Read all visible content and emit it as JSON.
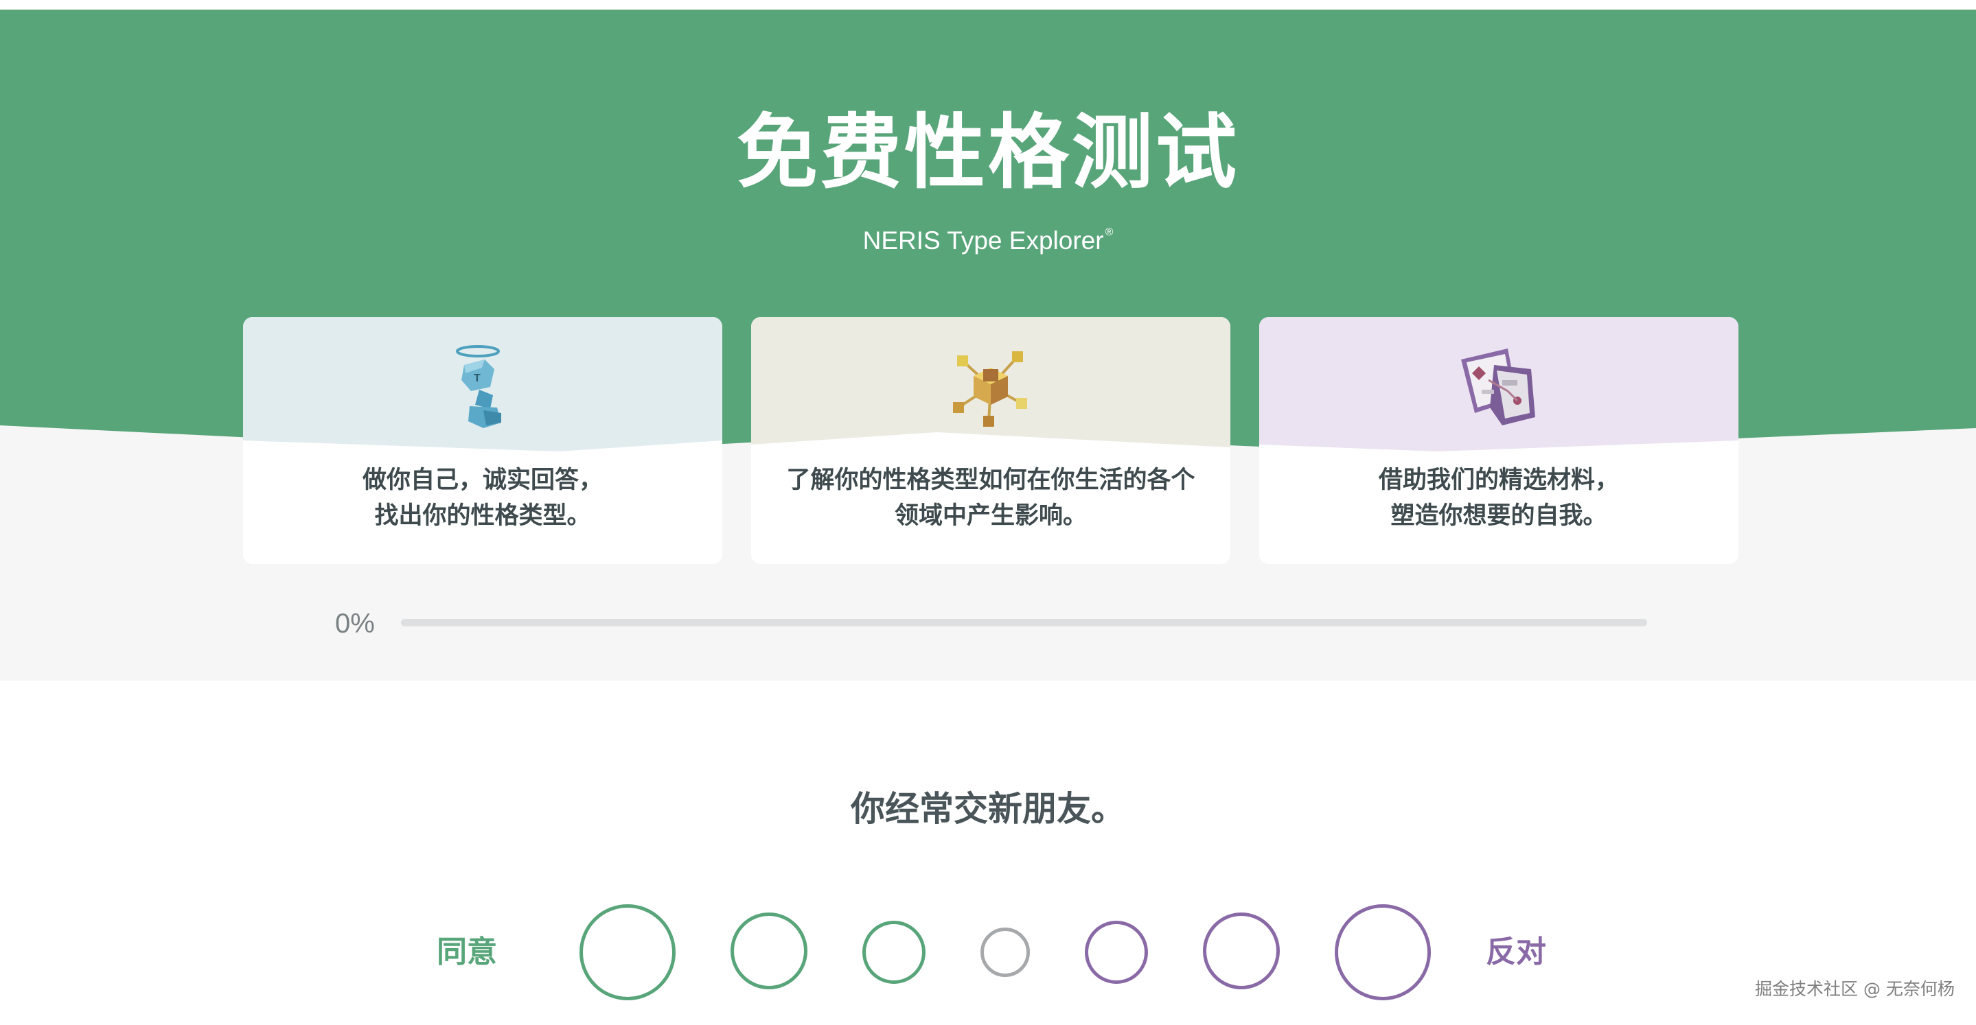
{
  "hero": {
    "title": "免费性格测试",
    "subtitle": "NERIS Type Explorer",
    "subtitle_mark": "®"
  },
  "cards": [
    {
      "icon": "cube-figure-with-halo-icon",
      "line1": "做你自己，诚实回答，",
      "line2": "找出你的性格类型。",
      "tint": "#e1ecee"
    },
    {
      "icon": "connected-cubes-icon",
      "line1": "了解你的性格类型如何在你生活的各个",
      "line2": "领域中产生影响。",
      "tint": "#ecebe2"
    },
    {
      "icon": "maps-materials-icon",
      "line1": "借助我们的精选材料，",
      "line2": "塑造你想要的自我。",
      "tint": "#ebe3f2"
    }
  ],
  "progress": {
    "label": "0%",
    "value_percent": 0
  },
  "question": {
    "text": "你经常交新朋友。",
    "agree_label": "同意",
    "disagree_label": "反对",
    "options": [
      "strongly-agree",
      "agree",
      "slightly-agree",
      "neutral",
      "slightly-disagree",
      "disagree",
      "strongly-disagree"
    ]
  },
  "colors": {
    "brand_green": "#58a57a",
    "brand_purple": "#8a6aa6",
    "neutral_gray": "#a5a9ab",
    "band_gray": "#f6f6f6"
  },
  "watermark": "掘金技术社区 @ 无奈何杨"
}
